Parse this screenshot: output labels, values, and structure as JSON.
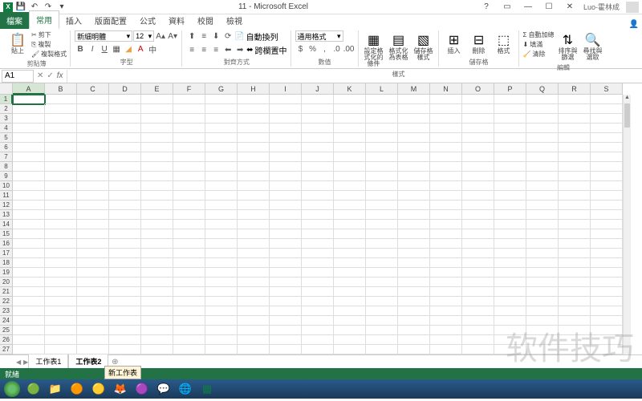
{
  "title": "11 - Microsoft Excel",
  "user": "Luo-霍林成",
  "qat": {
    "save": "💾",
    "undo": "↶",
    "redo": "↷"
  },
  "tabs": {
    "file": "檔案",
    "items": [
      "常用",
      "插入",
      "版面配置",
      "公式",
      "資料",
      "校閱",
      "檢視"
    ],
    "active": 0
  },
  "ribbon": {
    "clipboard": {
      "paste": "貼上",
      "cut": "剪下",
      "copy": "複製",
      "format_painter": "複製格式",
      "label": "剪貼簿"
    },
    "font": {
      "name": "新細明體",
      "size": "12",
      "label": "字型"
    },
    "alignment": {
      "wrap": "自動換列",
      "merge": "跨欄置中",
      "label": "對齊方式"
    },
    "number": {
      "format": "通用格式",
      "label": "數值"
    },
    "styles": {
      "cond": "設定格式化的條件",
      "table": "格式化為表格",
      "cell": "儲存格樣式",
      "label": "樣式"
    },
    "cells": {
      "insert": "插入",
      "delete": "刪除",
      "format": "格式",
      "label": "儲存格"
    },
    "editing": {
      "autosum": "自動加總",
      "fill": "填滿",
      "clear": "清除",
      "sort": "排序與篩選",
      "find": "尋找與選取",
      "label": "編輯"
    }
  },
  "namebox": "A1",
  "formula": "",
  "columns": [
    "A",
    "B",
    "C",
    "D",
    "E",
    "F",
    "G",
    "H",
    "I",
    "J",
    "K",
    "L",
    "M",
    "N",
    "O",
    "P",
    "Q",
    "R",
    "S"
  ],
  "rows": [
    1,
    2,
    3,
    4,
    5,
    6,
    7,
    8,
    9,
    10,
    11,
    12,
    13,
    14,
    15,
    16,
    17,
    18,
    19,
    20,
    21,
    22,
    23,
    24,
    25,
    26,
    27
  ],
  "sheets": {
    "tabs": [
      "工作表1",
      "工作表2"
    ],
    "active": 1,
    "tooltip": "新工作表"
  },
  "status": "就緒",
  "watermark": "软件技巧",
  "chart_data": null
}
